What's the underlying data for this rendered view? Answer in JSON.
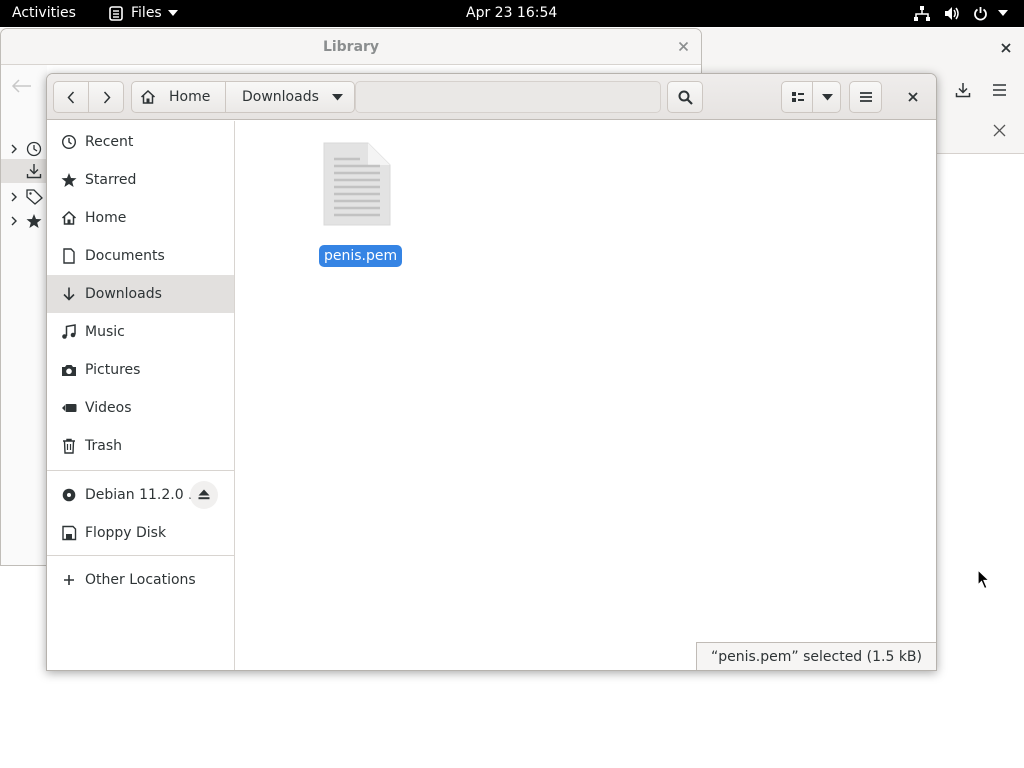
{
  "topbar": {
    "activities": "Activities",
    "app_menu": "Files",
    "clock": "Apr 23  16:54"
  },
  "library": {
    "title": "Library"
  },
  "dialog": {
    "path": [
      "Home",
      "Downloads"
    ],
    "sidebar": {
      "places": [
        {
          "label": "Recent",
          "icon": "recent-icon"
        },
        {
          "label": "Starred",
          "icon": "star-icon"
        },
        {
          "label": "Home",
          "icon": "home-icon"
        },
        {
          "label": "Documents",
          "icon": "document-icon"
        },
        {
          "label": "Downloads",
          "icon": "download-icon",
          "selected": true
        },
        {
          "label": "Music",
          "icon": "music-icon"
        },
        {
          "label": "Pictures",
          "icon": "camera-icon"
        },
        {
          "label": "Videos",
          "icon": "video-icon"
        },
        {
          "label": "Trash",
          "icon": "trash-icon"
        }
      ],
      "devices": [
        {
          "label": "Debian 11.2.0 ...",
          "icon": "disc-icon"
        },
        {
          "label": "Floppy Disk",
          "icon": "floppy-icon"
        }
      ],
      "other": {
        "label": "Other Locations",
        "icon": "plus-icon"
      }
    },
    "files": [
      {
        "name": "penis.pem",
        "selected": true
      }
    ],
    "status": "“penis.pem” selected  (1.5 kB)"
  },
  "colors": {
    "selection": "#3584e4",
    "topbar": "#000000"
  }
}
